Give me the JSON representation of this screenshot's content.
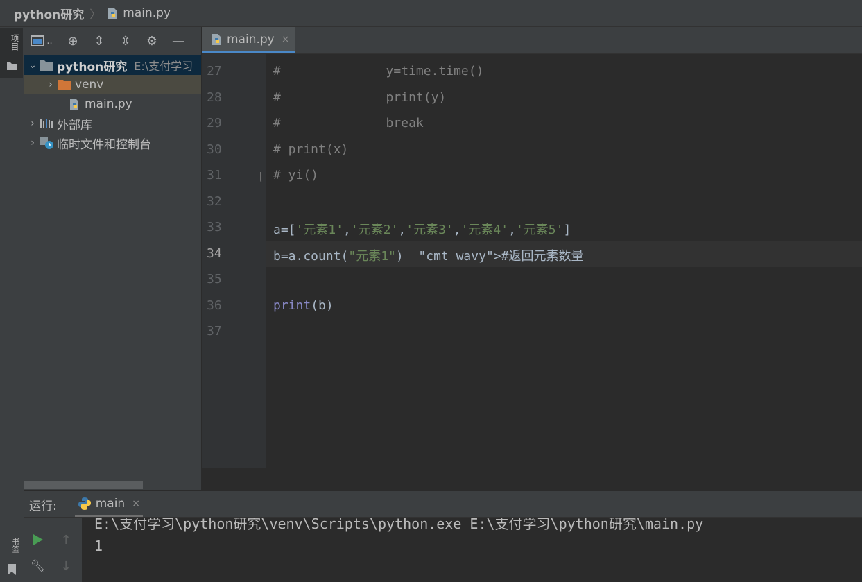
{
  "navbar": {
    "project": "python研究",
    "file": "main.py"
  },
  "left_strip": {
    "project_tab": "项目",
    "bookmarks_tab": "书签"
  },
  "project_panel": {
    "root": {
      "name": "python研究",
      "path": "E:\\支付学习"
    },
    "items": [
      {
        "name": "venv",
        "icon": "folder-icon"
      },
      {
        "name": "main.py",
        "icon": "python-file-icon"
      },
      {
        "name": "外部库",
        "icon": "library-icon"
      },
      {
        "name": "临时文件和控制台",
        "icon": "scratches-icon"
      }
    ],
    "toolbar_first": ".."
  },
  "editor": {
    "tab": {
      "label": "main.py",
      "close": "×"
    },
    "current_line": "34",
    "lines": [
      {
        "num": "27",
        "text": "#              y=time.time()"
      },
      {
        "num": "28",
        "text": "#              print(y)"
      },
      {
        "num": "29",
        "text": "#              break"
      },
      {
        "num": "30",
        "text": "# print(x)"
      },
      {
        "num": "31",
        "text": "# yi()"
      },
      {
        "num": "32",
        "text": ""
      },
      {
        "num": "33",
        "text": "a=['元素1','元素2','元素3','元素4','元素5']"
      },
      {
        "num": "34",
        "text": "b=a.count(\"元素1\")  #返回元素数量"
      },
      {
        "num": "35",
        "text": ""
      },
      {
        "num": "36",
        "text": "print(b)"
      },
      {
        "num": "37",
        "text": ""
      }
    ]
  },
  "run_panel": {
    "title": "运行:",
    "tab": {
      "label": "main",
      "close": "×"
    },
    "console": [
      "E:\\支付学习\\python研究\\venv\\Scripts\\python.exe E:\\支付学习\\python研究\\main.py",
      "1"
    ]
  },
  "colors": {
    "background": "#2b2b2b",
    "panel": "#3c3f41",
    "comment": "#808080",
    "string": "#6a8759",
    "builtin": "#8888c6",
    "selection": "#0d293e",
    "tab_underline": "#4a88c7"
  }
}
